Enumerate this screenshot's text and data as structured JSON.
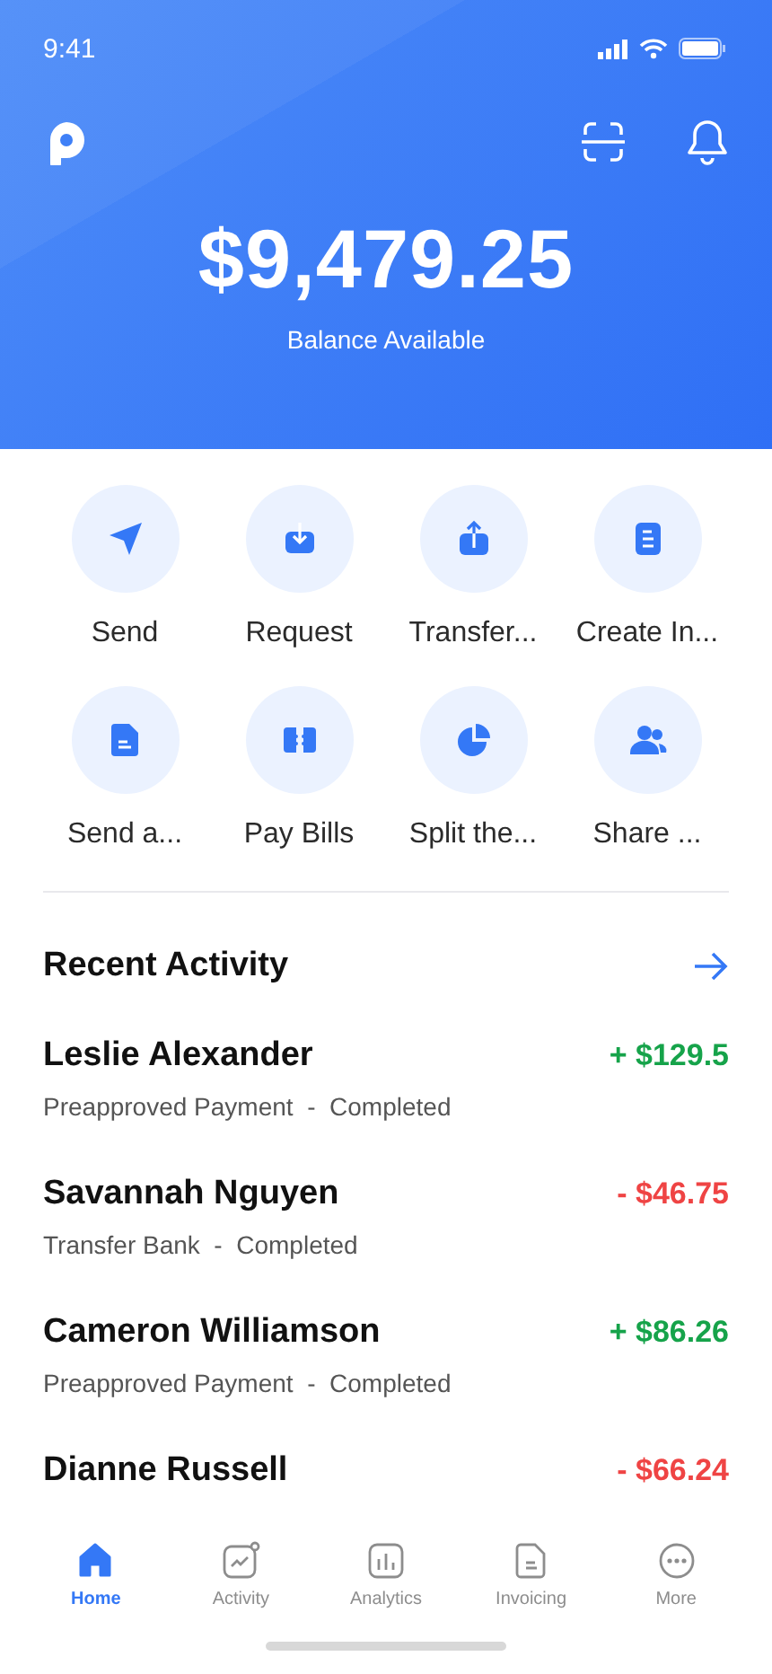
{
  "status_bar": {
    "time": "9:41"
  },
  "balance": {
    "amount": "$9,479.25",
    "caption": "Balance Available"
  },
  "actions": [
    {
      "label": "Send"
    },
    {
      "label": "Request"
    },
    {
      "label": "Transfer..."
    },
    {
      "label": "Create In..."
    },
    {
      "label": "Send a..."
    },
    {
      "label": "Pay Bills"
    },
    {
      "label": "Split the..."
    },
    {
      "label": "Share ..."
    }
  ],
  "recent_activity": {
    "title": "Recent Activity",
    "items": [
      {
        "name": "Leslie Alexander",
        "details": "Preapproved Payment  -  Completed",
        "amount": "+ $129.5",
        "kind": "credit"
      },
      {
        "name": "Savannah Nguyen",
        "details": "Transfer Bank  -  Completed",
        "amount": "- $46.75",
        "kind": "debit"
      },
      {
        "name": "Cameron Williamson",
        "details": "Preapproved Payment  -  Completed",
        "amount": "+ $86.26",
        "kind": "credit"
      },
      {
        "name": "Dianne Russell",
        "amount": "- $66.24",
        "kind": "debit"
      }
    ]
  },
  "nav": [
    {
      "label": "Home",
      "selected": true
    },
    {
      "label": "Activity",
      "selected": false
    },
    {
      "label": "Analytics",
      "selected": false
    },
    {
      "label": "Invoicing",
      "selected": false
    },
    {
      "label": "More",
      "selected": false
    }
  ]
}
